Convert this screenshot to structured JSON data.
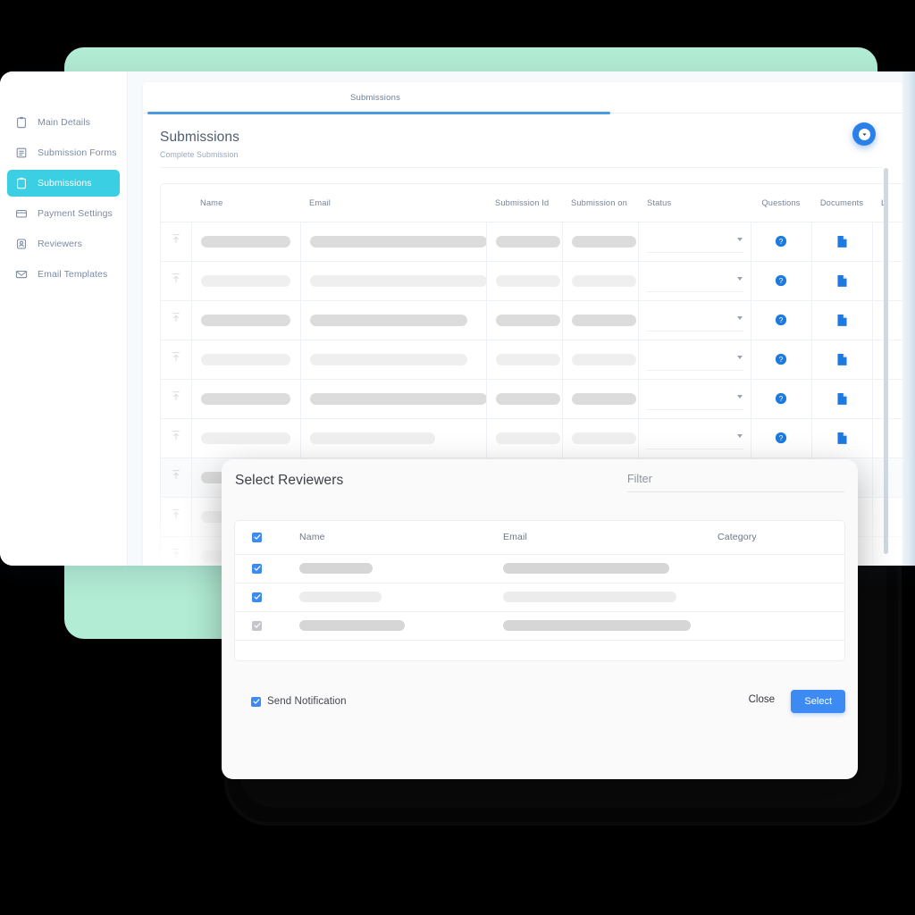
{
  "sidebar": {
    "items": [
      {
        "label": "Main Details",
        "icon": "clipboard-icon",
        "active": false
      },
      {
        "label": "Submission Forms",
        "icon": "document-icon",
        "active": false
      },
      {
        "label": "Submissions",
        "icon": "clipboard-icon",
        "active": true
      },
      {
        "label": "Payment Settings",
        "icon": "credit-card-icon",
        "active": false
      },
      {
        "label": "Reviewers",
        "icon": "contact-card-icon",
        "active": false
      },
      {
        "label": "Email Templates",
        "icon": "envelope-icon",
        "active": false
      }
    ]
  },
  "content": {
    "tab_label": "Submissions",
    "page_title": "Submissions",
    "page_subtitle": "Complete Submission",
    "fab_icon": "chevron-down-icon",
    "table": {
      "columns": [
        {
          "label": "",
          "name": "row-handle-column"
        },
        {
          "label": "Name",
          "name": "column-name"
        },
        {
          "label": "Email",
          "name": "column-email"
        },
        {
          "label": "Submission Id",
          "name": "column-submission-id"
        },
        {
          "label": "Submission on",
          "name": "column-submission-on"
        },
        {
          "label": "Status",
          "name": "column-status"
        },
        {
          "label": "Questions",
          "name": "column-questions"
        },
        {
          "label": "Documents",
          "name": "column-documents"
        },
        {
          "label": "L",
          "name": "column-truncated"
        }
      ],
      "rows": [
        {
          "shade": "dark",
          "name_w": 100,
          "email_w": 198,
          "id_w": 72,
          "on_w": 72,
          "alt": false
        },
        {
          "shade": "light",
          "name_w": 100,
          "email_w": 198,
          "id_w": 72,
          "on_w": 72,
          "alt": false
        },
        {
          "shade": "dark",
          "name_w": 100,
          "email_w": 176,
          "id_w": 72,
          "on_w": 72,
          "alt": false
        },
        {
          "shade": "light",
          "name_w": 100,
          "email_w": 176,
          "id_w": 72,
          "on_w": 72,
          "alt": false
        },
        {
          "shade": "dark",
          "name_w": 100,
          "email_w": 198,
          "id_w": 72,
          "on_w": 72,
          "alt": false
        },
        {
          "shade": "light",
          "name_w": 100,
          "email_w": 140,
          "id_w": 72,
          "on_w": 72,
          "alt": false
        },
        {
          "shade": "dark",
          "name_w": 100,
          "email_w": 140,
          "id_w": 72,
          "on_w": 72,
          "alt": true
        },
        {
          "shade": "light",
          "name_w": 100,
          "email_w": 170,
          "id_w": 72,
          "on_w": 72,
          "alt": false
        },
        {
          "shade": "light",
          "name_w": 100,
          "email_w": 170,
          "id_w": 72,
          "on_w": 72,
          "alt": false
        },
        {
          "shade": "light",
          "name_w": 100,
          "email_w": 170,
          "id_w": 72,
          "on_w": 72,
          "alt": false
        }
      ],
      "cell_icons": {
        "questions": "help-circle-icon",
        "documents": "file-icon",
        "handle": "upload-arrow-icon"
      }
    }
  },
  "modal": {
    "title": "Select Reviewers",
    "filter": {
      "placeholder": "Filter",
      "value": ""
    },
    "table": {
      "columns": [
        {
          "label": "",
          "name": "select-all-column"
        },
        {
          "label": "Name",
          "name": "column-name"
        },
        {
          "label": "Email",
          "name": "column-email"
        },
        {
          "label": "Category",
          "name": "column-category"
        }
      ],
      "header_checked": true,
      "rows": [
        {
          "checked": true,
          "disabled": false,
          "name_w": 82,
          "email_w": 186,
          "shade": "dark"
        },
        {
          "checked": true,
          "disabled": false,
          "name_w": 92,
          "email_w": 194,
          "shade": "light"
        },
        {
          "checked": true,
          "disabled": true,
          "name_w": 118,
          "email_w": 210,
          "shade": "dark"
        }
      ]
    },
    "send_notification": {
      "label": "Send Notification",
      "checked": true
    },
    "close_label": "Close",
    "select_label": "Select"
  },
  "colors": {
    "accent_cyan": "#3bcfe3",
    "accent_blue": "#3d8bf2",
    "tab_underline": "#4a9ae0",
    "backdrop_green": "#b2ecd4",
    "frame_black": "#060606"
  }
}
